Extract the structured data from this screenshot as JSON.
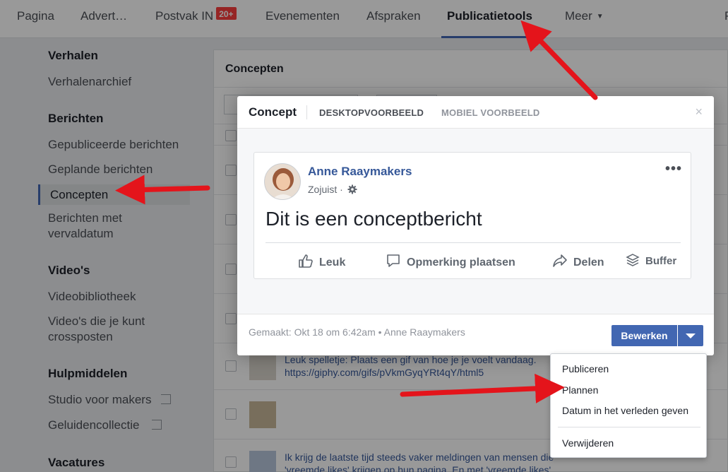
{
  "topnav": {
    "items": [
      "Pagina",
      "Advert…",
      "Postvak IN",
      "Evenementen",
      "Afspraken",
      "Publicatietools",
      "Meer"
    ],
    "inbox_badge": "20+",
    "active": "Publicatietools",
    "edge_letter": "P"
  },
  "sidebar": {
    "sections": [
      {
        "heading": "Verhalen",
        "items": [
          "Verhalenarchief"
        ]
      },
      {
        "heading": "Berichten",
        "items": [
          "Gepubliceerde berichten",
          "Geplande berichten",
          "Concepten",
          "Berichten met vervaldatum"
        ]
      },
      {
        "heading": "Video's",
        "items": [
          "Videobibliotheek",
          "Video's die je kunt crossposten"
        ]
      },
      {
        "heading": "Hulpmiddelen",
        "items": [
          "Studio voor makers",
          "Geluidencollectie"
        ]
      },
      {
        "heading": "Vacatures",
        "items": []
      }
    ],
    "selected": "Concepten"
  },
  "main": {
    "title": "Concepten",
    "rows": [
      {
        "text": "Leuk spelletje: Plaats een gif van hoe je je voelt vandaag. https://giphy.com/gifs/pVkmGyqYRt4qY/html5"
      },
      {
        "text": ""
      },
      {
        "text": "Ik krijg de laatste tijd steeds vaker meldingen van mensen die 'vreemde likes' krijgen op hun pagina. En met 'vreemde likes'"
      }
    ]
  },
  "modal": {
    "title": "Concept",
    "tabs": [
      "DESKTOPVOORBEELD",
      "MOBIEL VOORBEELD"
    ],
    "close": "×",
    "post": {
      "author": "Anne Raaymakers",
      "time": "Zojuist ·",
      "text": "Dit is een conceptbericht",
      "actions": [
        "Leuk",
        "Opmerking plaatsen",
        "Delen",
        "Buffer"
      ]
    },
    "footer_meta": "Gemaakt: Okt 18 om 6:42am • Anne Raaymakers",
    "edit_label": "Bewerken"
  },
  "menu": {
    "items": [
      "Publiceren",
      "Plannen",
      "Datum in het verleden geven",
      "Verwijderen"
    ]
  },
  "colors": {
    "accent": "#4267b2",
    "link": "#365899",
    "arrow": "#e4141b",
    "badge": "#fa3e3e"
  }
}
